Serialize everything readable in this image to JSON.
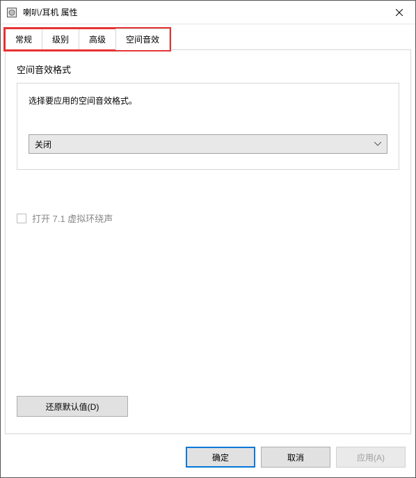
{
  "window": {
    "title": "喇叭/耳机 属性"
  },
  "tabs": [
    {
      "label": "常规"
    },
    {
      "label": "级别"
    },
    {
      "label": "高级"
    },
    {
      "label": "空间音效",
      "active": true
    }
  ],
  "panel": {
    "group_title": "空间音效格式",
    "group_desc": "选择要应用的空间音效格式。",
    "dropdown_value": "关闭",
    "surround_checkbox_label": "打开 7.1 虚拟环绕声",
    "surround_checked": false,
    "restore_defaults_label": "还原默认值(D)"
  },
  "footer": {
    "ok_label": "确定",
    "cancel_label": "取消",
    "apply_label": "应用(A)",
    "apply_enabled": false
  },
  "annotation": {
    "highlight_tab_count": 4
  }
}
